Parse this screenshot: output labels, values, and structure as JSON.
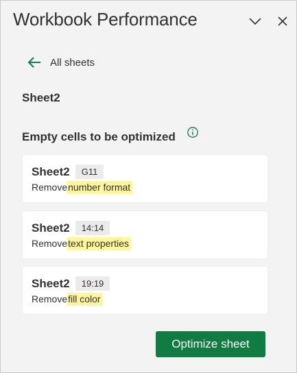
{
  "header": {
    "title": "Workbook Performance",
    "collapse_icon": "chevron-down-icon",
    "close_icon": "close-icon"
  },
  "nav": {
    "back_label": "All sheets",
    "back_icon": "arrow-left-icon"
  },
  "sheet": {
    "name": "Sheet2"
  },
  "section": {
    "title": "Empty cells to be optimized",
    "info_icon": "info-icon"
  },
  "cards": [
    {
      "sheet": "Sheet2",
      "ref": "G11",
      "action": "Remove",
      "detail": "number format"
    },
    {
      "sheet": "Sheet2",
      "ref": "14:14",
      "action": "Remove",
      "detail": "text properties"
    },
    {
      "sheet": "Sheet2",
      "ref": "19:19",
      "action": "Remove",
      "detail": "fill color"
    }
  ],
  "actions": {
    "optimize_label": "Optimize sheet"
  },
  "colors": {
    "accent": "#107c41",
    "highlight": "#fff59d",
    "pane_bg": "#f3f3f3"
  }
}
